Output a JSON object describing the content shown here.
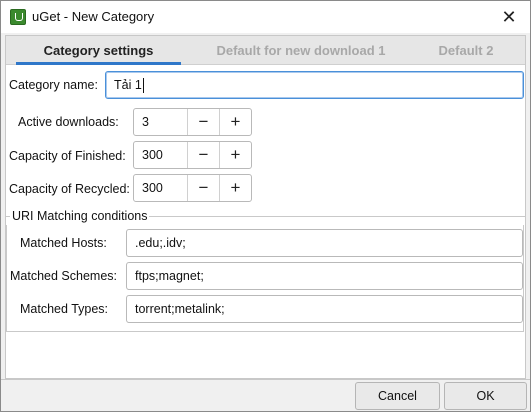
{
  "window": {
    "title": "uGet - New Category"
  },
  "tabs": [
    {
      "label": "Category settings"
    },
    {
      "label": "Default for new download 1"
    },
    {
      "label": "Default 2"
    }
  ],
  "form": {
    "category_name_label": "Category name:",
    "category_name_value": "Tải 1",
    "active_downloads_label": "Active downloads:",
    "active_downloads_value": "3",
    "capacity_finished_label": "Capacity of Finished:",
    "capacity_finished_value": "300",
    "capacity_recycled_label": "Capacity of Recycled:",
    "capacity_recycled_value": "300",
    "minus_glyph": "−",
    "plus_glyph": "+"
  },
  "uri_matching": {
    "title": "URI Matching conditions",
    "hosts_label": "Matched Hosts:",
    "hosts_value": ".edu;.idv;",
    "schemes_label": "Matched Schemes:",
    "schemes_value": "ftps;magnet;",
    "types_label": "Matched Types:",
    "types_value": "torrent;metalink;"
  },
  "buttons": {
    "cancel": "Cancel",
    "ok": "OK"
  },
  "icons": {
    "app": "uget-app-icon",
    "close": "close-icon"
  },
  "colors": {
    "accent": "#2f77c9",
    "app_icon": "#3b8a2e"
  }
}
